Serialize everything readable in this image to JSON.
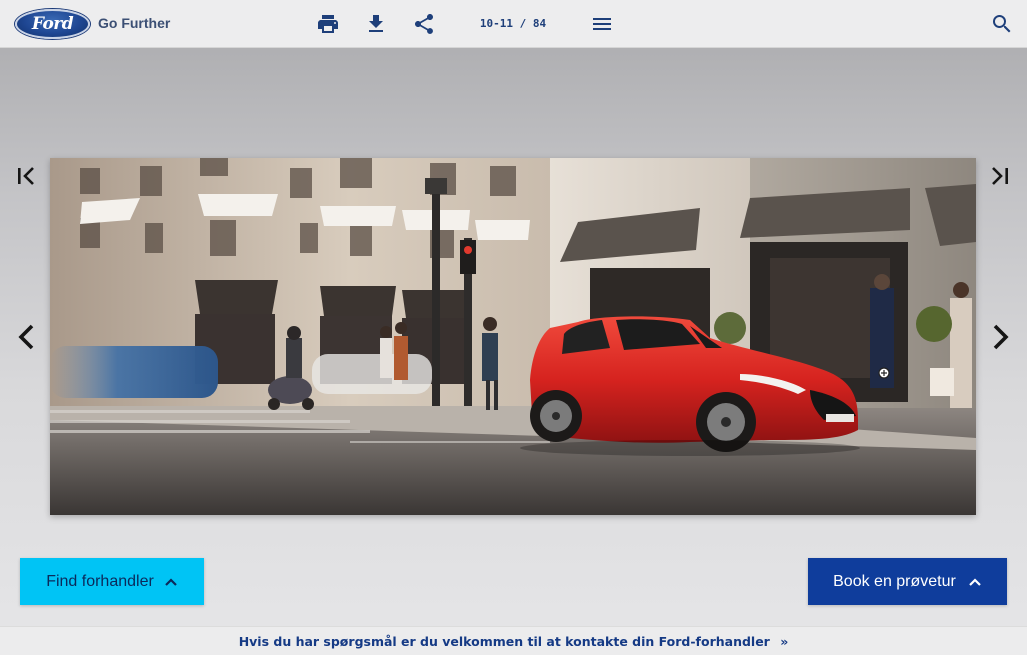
{
  "brand": {
    "logo_text": "Ford",
    "tagline": "Go Further"
  },
  "toolbar": {
    "print_icon": "print-icon",
    "download_icon": "download-icon",
    "share_icon": "share-icon",
    "page_indicator": "10-11 / 84",
    "menu_icon": "menu-icon",
    "search_icon": "search-icon"
  },
  "viewer": {
    "image_alt": "Red Ford Fiesta in city street",
    "zoom_icon": "zoom-in-icon"
  },
  "buttons": {
    "find_dealer": "Find forhandler",
    "book_test_drive": "Book en prøvetur"
  },
  "footer": {
    "contact_text": "Hvis du har spørgsmål er du velkommen til at kontakte din Ford-forhandler",
    "contact_arrow": "»"
  },
  "colors": {
    "ford_blue": "#1f4793",
    "find_dealer_bg": "#00c4f5",
    "book_bg": "#0f3d9c",
    "car_red": "#d6231f"
  }
}
